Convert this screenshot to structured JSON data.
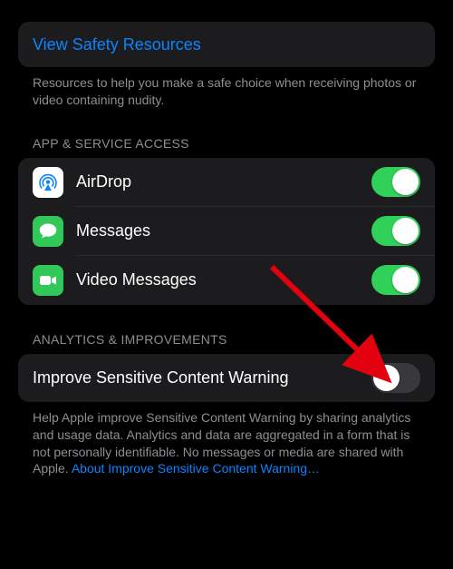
{
  "resources": {
    "link_label": "View Safety Resources",
    "footer": "Resources to help you make a safe choice when receiving photos or video containing nudity."
  },
  "app_access": {
    "header": "APP & SERVICE ACCESS",
    "items": [
      {
        "label": "AirDrop",
        "on": true
      },
      {
        "label": "Messages",
        "on": true
      },
      {
        "label": "Video Messages",
        "on": true
      }
    ]
  },
  "analytics": {
    "header": "ANALYTICS & IMPROVEMENTS",
    "row_label": "Improve Sensitive Content Warning",
    "on": false,
    "footer_plain": "Help Apple improve Sensitive Content Warning by sharing analytics and usage data. Analytics and data are aggregated in a form that is not personally identifiable. No messages or media are shared with Apple. ",
    "footer_link": "About Improve Sensitive Content Warning…"
  }
}
